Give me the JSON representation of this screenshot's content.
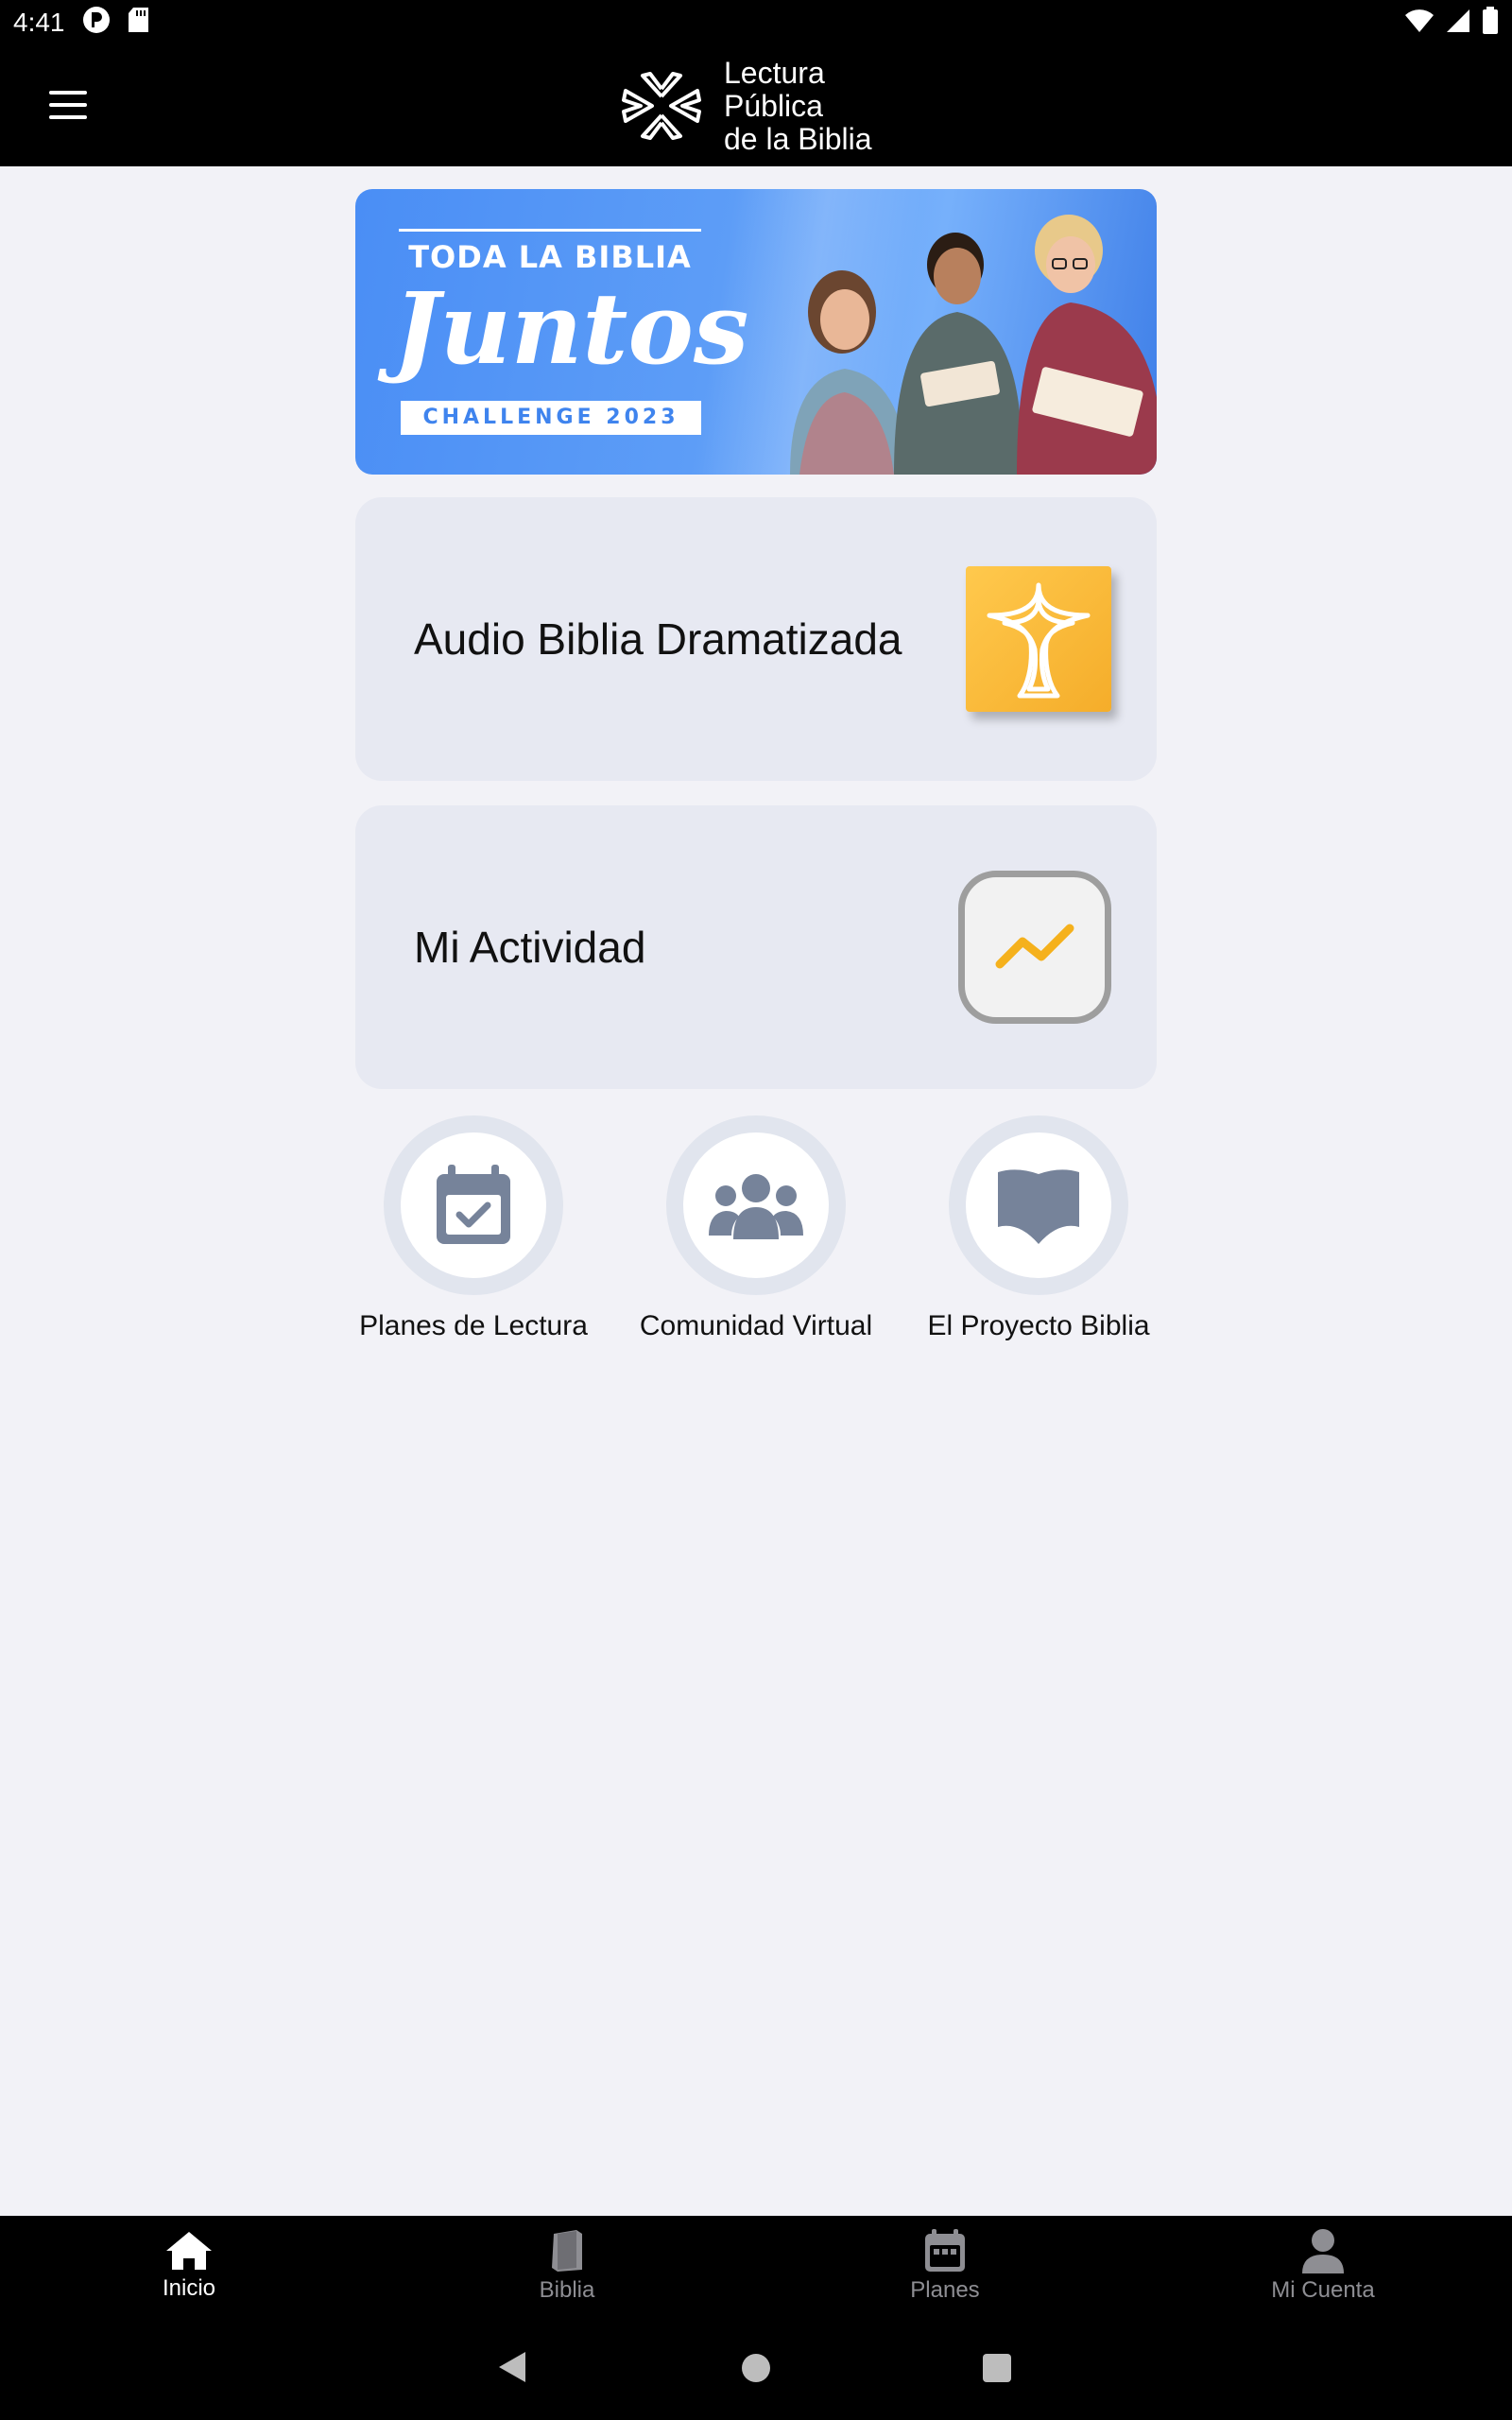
{
  "status_bar": {
    "time": "4:41"
  },
  "app_bar": {
    "logo_lines": [
      "Lectura",
      "Pública",
      "de la Biblia"
    ]
  },
  "banner": {
    "line1": "TODA LA BIBLIA",
    "line2": "Juntos",
    "line3": "CHALLENGE 2023"
  },
  "cards": {
    "audio": {
      "label": "Audio Biblia Dramatizada"
    },
    "activity": {
      "label": "Mi Actividad"
    }
  },
  "shortcuts": [
    {
      "label": "Planes de Lectura",
      "icon": "calendar-check-icon"
    },
    {
      "label": "Comunidad Virtual",
      "icon": "people-group-icon"
    },
    {
      "label": "El Proyecto Biblia",
      "icon": "open-book-icon"
    }
  ],
  "bottom_nav": [
    {
      "label": "Inicio",
      "icon": "home-icon",
      "active": true
    },
    {
      "label": "Biblia",
      "icon": "bible-icon",
      "active": false
    },
    {
      "label": "Planes",
      "icon": "calendar-icon",
      "active": false
    },
    {
      "label": "Mi Cuenta",
      "icon": "person-icon",
      "active": false
    }
  ],
  "colors": {
    "accent_blue": "#4a8ef5",
    "gold": "#f5ad2a",
    "card_bg": "#e7e9f2",
    "icon_slate": "#76839a"
  }
}
